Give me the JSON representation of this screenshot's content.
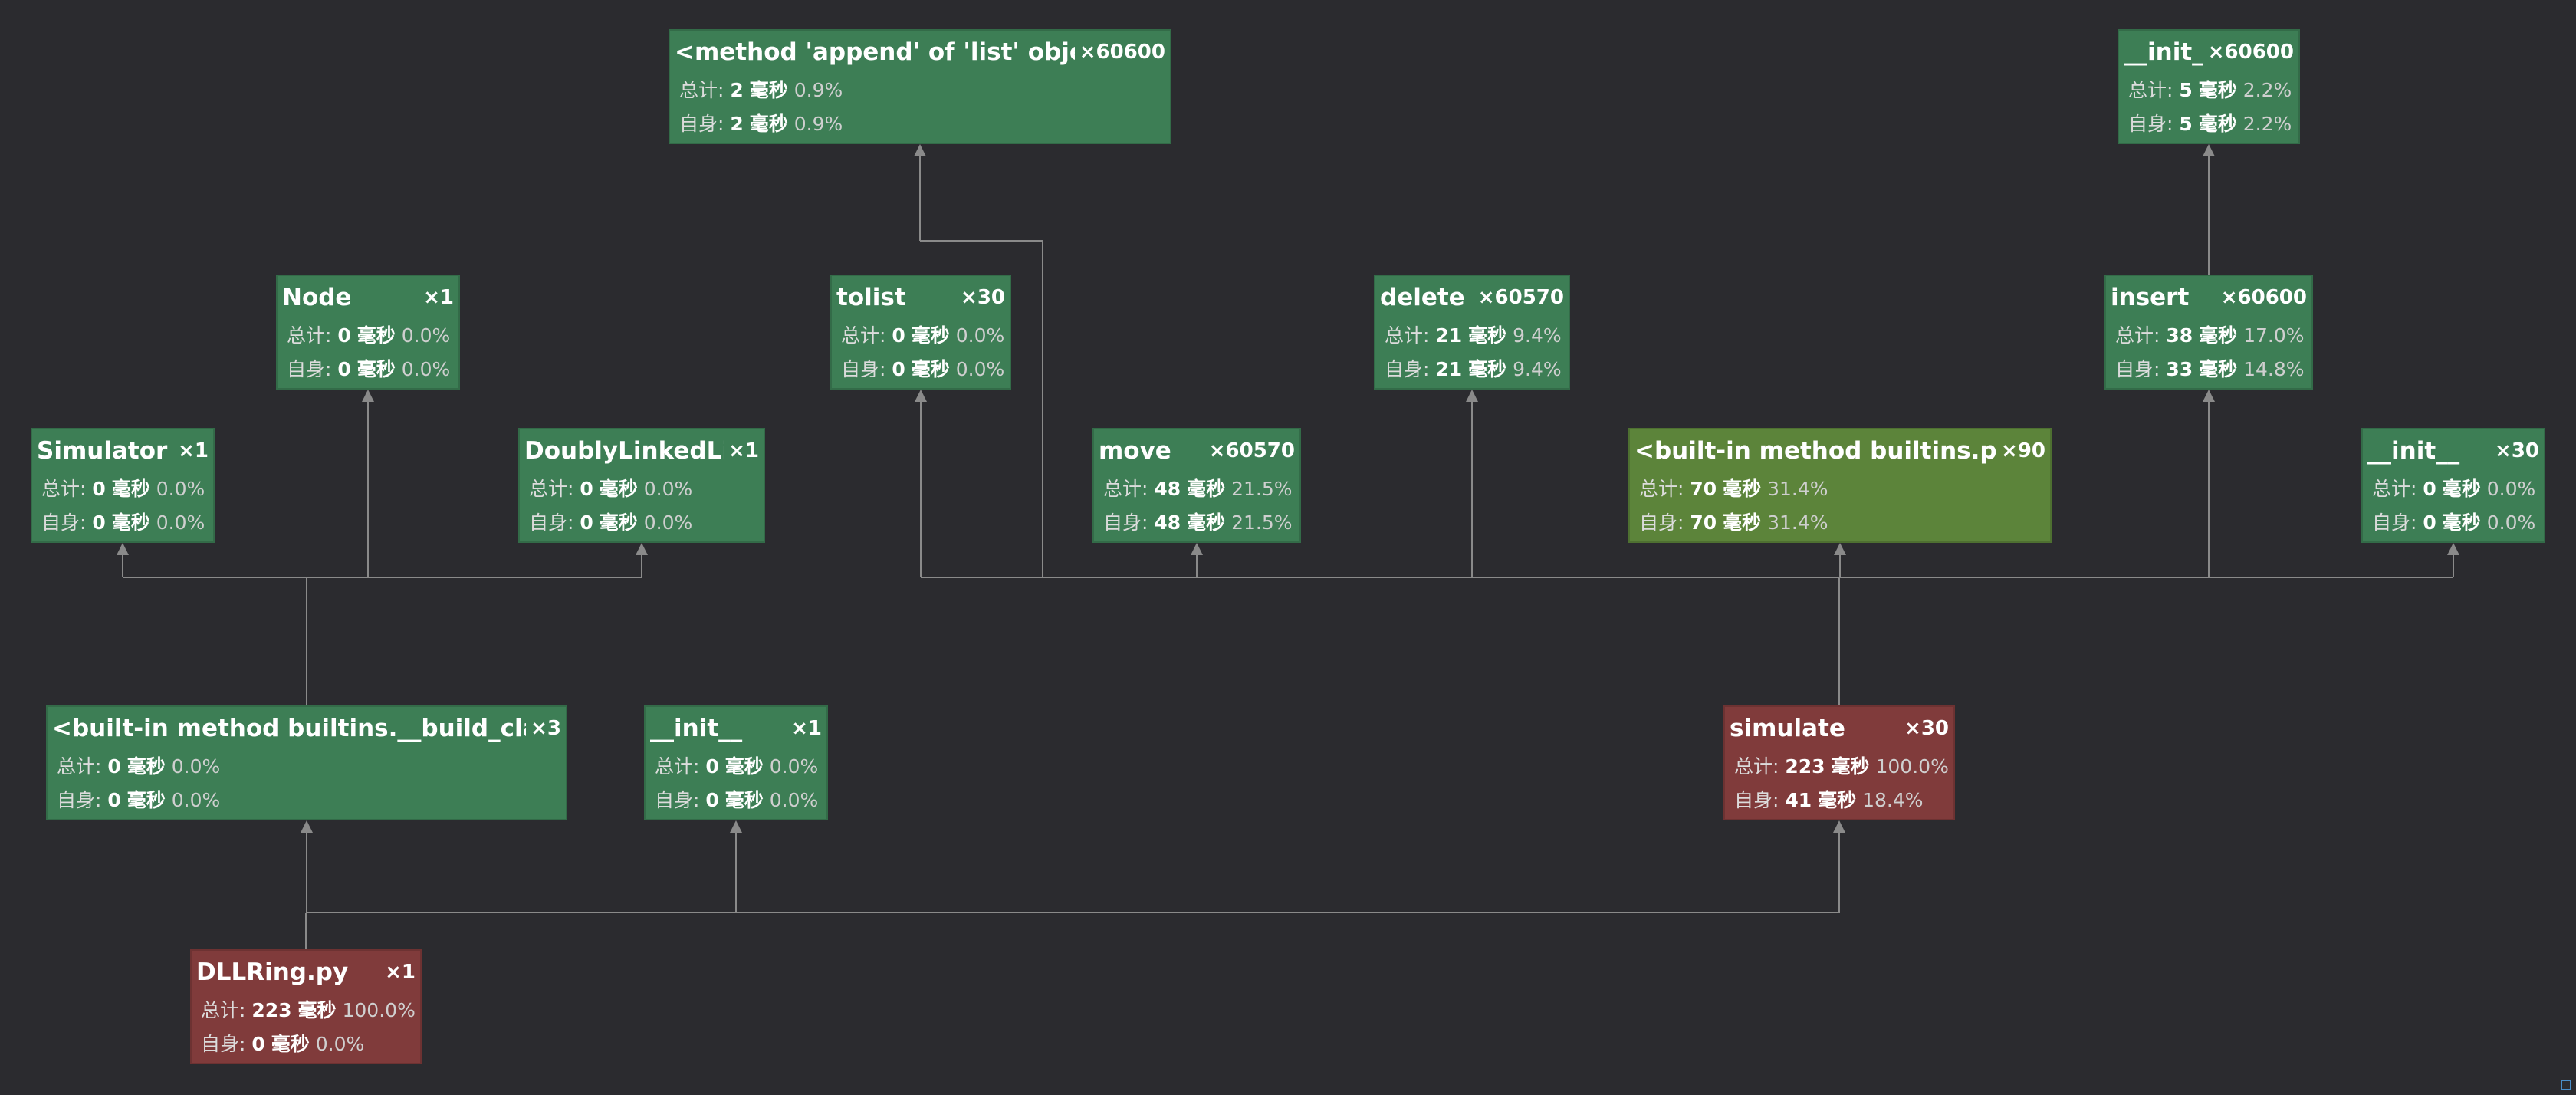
{
  "labels": {
    "total": "总计:",
    "self": "自身:",
    "unit": "毫秒"
  },
  "colors": {
    "background": "#2b2b2f",
    "green": "#3d7e55",
    "olive": "#5c843a",
    "red": "#803b3b",
    "edge": "#8a8a8a"
  },
  "nodes": [
    {
      "id": "append",
      "name": "<method 'append' of 'list' objects>",
      "count": "×60600",
      "total": "2",
      "total_pct": "0.9%",
      "self": "2",
      "self_pct": "0.9%",
      "color": "green"
    },
    {
      "id": "init_insert",
      "name": "__init__",
      "count": "×60600",
      "total": "5",
      "total_pct": "2.2%",
      "self": "5",
      "self_pct": "2.2%",
      "color": "green"
    },
    {
      "id": "node",
      "name": "Node",
      "count": "×1",
      "total": "0",
      "total_pct": "0.0%",
      "self": "0",
      "self_pct": "0.0%",
      "color": "green"
    },
    {
      "id": "tolist",
      "name": "tolist",
      "count": "×30",
      "total": "0",
      "total_pct": "0.0%",
      "self": "0",
      "self_pct": "0.0%",
      "color": "green"
    },
    {
      "id": "delete",
      "name": "delete",
      "count": "×60570",
      "total": "21",
      "total_pct": "9.4%",
      "self": "21",
      "self_pct": "9.4%",
      "color": "green"
    },
    {
      "id": "insert",
      "name": "insert",
      "count": "×60600",
      "total": "38",
      "total_pct": "17.0%",
      "self": "33",
      "self_pct": "14.8%",
      "color": "green"
    },
    {
      "id": "simulator",
      "name": "Simulator",
      "count": "×1",
      "total": "0",
      "total_pct": "0.0%",
      "self": "0",
      "self_pct": "0.0%",
      "color": "green"
    },
    {
      "id": "dll",
      "name": "DoublyLinkedList",
      "count": "×1",
      "total": "0",
      "total_pct": "0.0%",
      "self": "0",
      "self_pct": "0.0%",
      "color": "green"
    },
    {
      "id": "move",
      "name": "move",
      "count": "×60570",
      "total": "48",
      "total_pct": "21.5%",
      "self": "48",
      "self_pct": "21.5%",
      "color": "green"
    },
    {
      "id": "print",
      "name": "<built-in method builtins.print>",
      "count": "×90",
      "total": "70",
      "total_pct": "31.4%",
      "self": "70",
      "self_pct": "31.4%",
      "color": "olive"
    },
    {
      "id": "init_sim",
      "name": "__init__",
      "count": "×30",
      "total": "0",
      "total_pct": "0.0%",
      "self": "0",
      "self_pct": "0.0%",
      "color": "green"
    },
    {
      "id": "build_class",
      "name": "<built-in method builtins.__build_class__>",
      "count": "×3",
      "total": "0",
      "total_pct": "0.0%",
      "self": "0",
      "self_pct": "0.0%",
      "color": "green"
    },
    {
      "id": "init_root",
      "name": "__init__",
      "count": "×1",
      "total": "0",
      "total_pct": "0.0%",
      "self": "0",
      "self_pct": "0.0%",
      "color": "green"
    },
    {
      "id": "simulate",
      "name": "simulate",
      "count": "×30",
      "total": "223",
      "total_pct": "100.0%",
      "self": "41",
      "self_pct": "18.4%",
      "color": "red"
    },
    {
      "id": "root",
      "name": "DLLRing.py",
      "count": "×1",
      "total": "223",
      "total_pct": "100.0%",
      "self": "0",
      "self_pct": "0.0%",
      "color": "red"
    }
  ],
  "edges": [
    [
      "root",
      "build_class"
    ],
    [
      "root",
      "init_root"
    ],
    [
      "root",
      "simulate"
    ],
    [
      "build_class",
      "simulator"
    ],
    [
      "build_class",
      "node"
    ],
    [
      "build_class",
      "dll"
    ],
    [
      "simulate",
      "tolist"
    ],
    [
      "simulate",
      "append"
    ],
    [
      "simulate",
      "move"
    ],
    [
      "simulate",
      "delete"
    ],
    [
      "simulate",
      "print"
    ],
    [
      "simulate",
      "insert"
    ],
    [
      "simulate",
      "init_sim"
    ],
    [
      "tolist",
      "append"
    ],
    [
      "insert",
      "init_insert"
    ]
  ]
}
